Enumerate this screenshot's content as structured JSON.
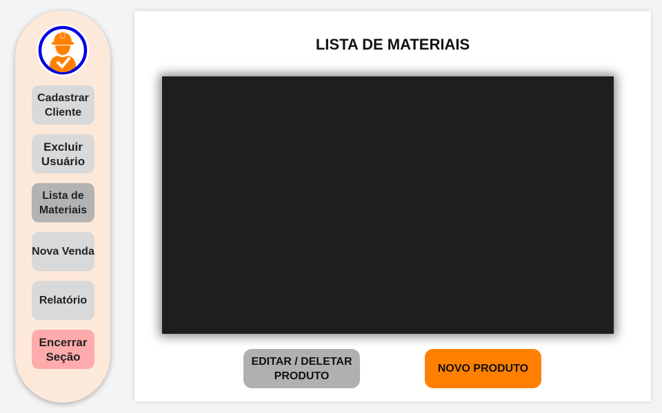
{
  "sidebar": {
    "items": [
      {
        "label": "Cadastrar Cliente"
      },
      {
        "label": "Excluir Usuário"
      },
      {
        "label": "Lista de Materiais",
        "active": true
      },
      {
        "label": "Nova Venda"
      },
      {
        "label": "Relatório"
      },
      {
        "label": "Encerrar Seção"
      }
    ]
  },
  "main": {
    "title": "LISTA DE MATERIAIS",
    "edit_button": "EDITAR / DELETAR PRODUTO",
    "new_button": "NOVO PRODUTO"
  },
  "colors": {
    "accent": "#ff8000",
    "sidebar_bg": "#fde9da",
    "logo_ring": "#0000e0",
    "danger": "#ffabab"
  }
}
